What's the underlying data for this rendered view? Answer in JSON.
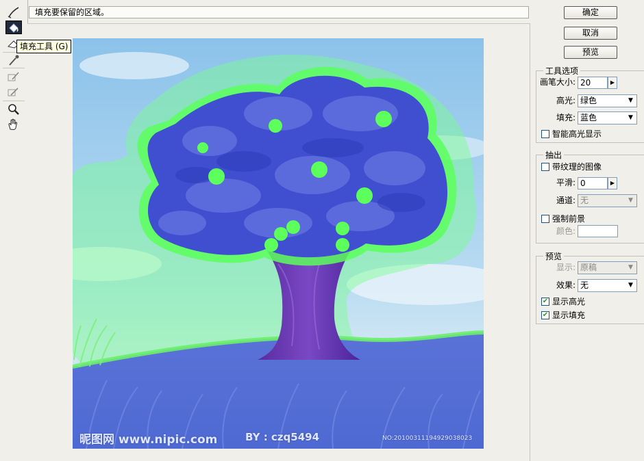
{
  "hint_text": "填充要保留的区域。",
  "tooltip": "填充工具 (G)",
  "tools": [
    {
      "name": "edge-highlighter-icon",
      "active": false
    },
    {
      "name": "fill-bucket-icon",
      "active": true
    },
    {
      "name": "eraser-icon",
      "active": false
    },
    {
      "name": "eyedropper-icon",
      "active": false
    },
    {
      "name": "cleanup-tool-icon",
      "active": false
    },
    {
      "name": "edge-touchup-icon",
      "active": false
    },
    {
      "name": "zoom-icon",
      "active": false
    },
    {
      "name": "hand-icon",
      "active": false
    }
  ],
  "buttons": {
    "ok": "确定",
    "cancel": "取消",
    "preview": "预览"
  },
  "tool_options": {
    "legend": "工具选项",
    "brush_size_label": "画笔大小:",
    "brush_size_value": "20",
    "highlight_label": "高光:",
    "highlight_value": "绿色",
    "fill_label": "填充:",
    "fill_value": "蓝色",
    "smart_highlight_label": "智能高光显示",
    "smart_highlight_checked": false
  },
  "extraction": {
    "legend": "抽出",
    "textured_label": "带纹理的图像",
    "textured_checked": false,
    "smooth_label": "平滑:",
    "smooth_value": "0",
    "channel_label": "通道:",
    "channel_value": "无",
    "force_fg_label": "强制前景",
    "force_fg_checked": false,
    "color_label": "颜色:"
  },
  "preview": {
    "legend": "预览",
    "show_label": "显示:",
    "show_value": "原稿",
    "effect_label": "效果:",
    "effect_value": "无",
    "show_highlight_label": "显示高光",
    "show_highlight_checked": true,
    "show_fill_label": "显示填充",
    "show_fill_checked": true
  },
  "image": {
    "watermark_site": "昵图网 www.nipic.com",
    "watermark_author": "BY : czq5494",
    "watermark_no": "NO:20100311194929038023"
  },
  "colors": {
    "highlight_green": "#5cf25c",
    "fill_blue": "#3f4fd0",
    "sky": "#8fc6ea"
  }
}
